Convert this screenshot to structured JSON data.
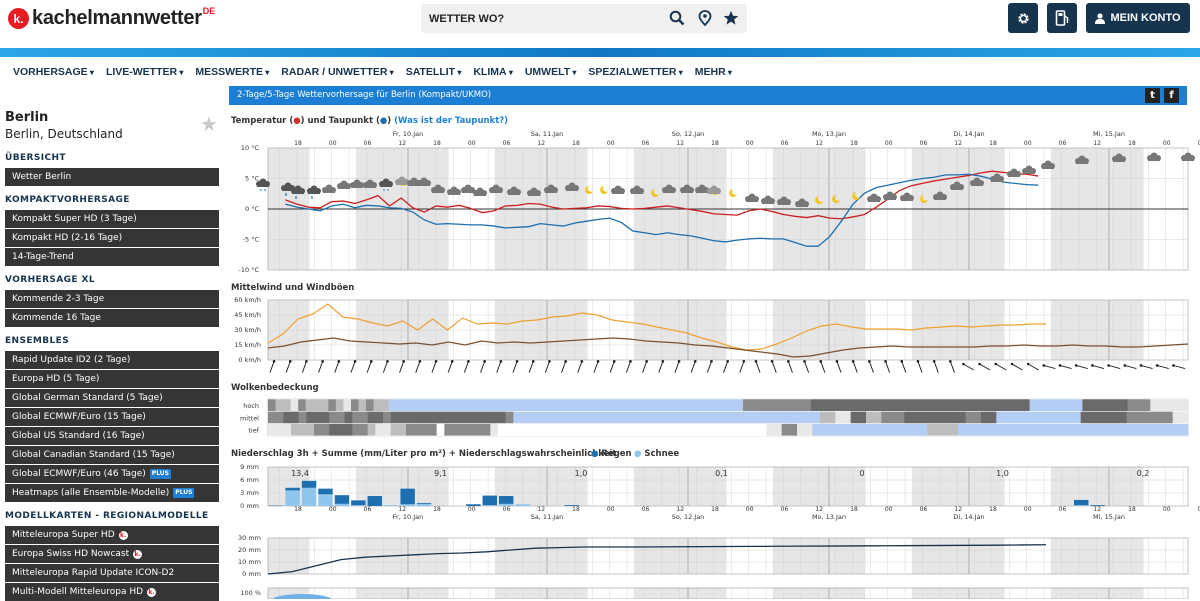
{
  "header": {
    "logo_letter": "k.",
    "logo_text": "kachelmannwetter",
    "logo_suffix": "DE",
    "search_placeholder": "WETTER WO?",
    "account_label": "MEIN KONTO"
  },
  "nav": [
    "VORHERSAGE",
    "LIVE-WETTER",
    "MESSWERTE",
    "RADAR / UNWETTER",
    "SATELLIT",
    "KLIMA",
    "UMWELT",
    "SPEZIALWETTER",
    "MEHR"
  ],
  "location": {
    "city": "Berlin",
    "country": "Berlin, Deutschland"
  },
  "sidebar": [
    {
      "title": "ÜBERSICHT",
      "items": [
        {
          "label": "Wetter Berlin"
        }
      ]
    },
    {
      "title": "KOMPAKTVORHERSAGE",
      "items": [
        {
          "label": "Kompakt Super HD (3 Tage)"
        },
        {
          "label": "Kompakt HD (2-16 Tage)"
        },
        {
          "label": "14-Tage-Trend"
        }
      ]
    },
    {
      "title": "VORHERSAGE XL",
      "items": [
        {
          "label": "Kommende 2-3 Tage"
        },
        {
          "label": "Kommende 16 Tage"
        }
      ]
    },
    {
      "title": "ENSEMBLES",
      "items": [
        {
          "label": "Rapid Update ID2 (2 Tage)"
        },
        {
          "label": "Europa HD (5 Tage)"
        },
        {
          "label": "Global German Standard (5 Tage)"
        },
        {
          "label": "Global ECMWF/Euro (15 Tage)"
        },
        {
          "label": "Global US Standard (16 Tage)"
        },
        {
          "label": "Global Canadian Standard (15 Tage)"
        },
        {
          "label": "Global ECMWF/Euro (46 Tage)",
          "badge": "PLUS"
        },
        {
          "label": "Heatmaps (alle Ensemble-Modelle)",
          "badge": "PLUS"
        }
      ]
    },
    {
      "title": "MODELLKARTEN - REGIONALMODELLE",
      "items": [
        {
          "label": "Mitteleuropa Super HD",
          "badge": "k."
        },
        {
          "label": "Europa Swiss HD Nowcast",
          "badge": "k."
        },
        {
          "label": "Mitteleuropa Rapid Update ICON-D2"
        },
        {
          "label": "Multi-Modell Mitteleuropa HD",
          "badge": "k."
        }
      ]
    }
  ],
  "banner": {
    "title": "2-Tage/5-Tage Wettervorhersage für Berlin (Kompakt/UKMO)"
  },
  "sections": {
    "temperature": {
      "title": "Temperatur (",
      "dot": "●",
      "mid": ") und Taupunkt (",
      "end": ")",
      "link": "(Was ist der Taupunkt?)"
    },
    "wind": {
      "title": "Mittelwind und Windböen"
    },
    "cloud": {
      "title": "Wolkenbedeckung",
      "levels": [
        "hoch",
        "mittel",
        "tief"
      ]
    },
    "precip": {
      "title": "Niederschlag 3h + Summe (mm/Liter pro m²) + Niederschlagswahrscheinlichkeit",
      "legend_rain": "Regen",
      "legend_snow": "Schnee"
    }
  },
  "chart_data": [
    {
      "type": "line",
      "title": "Temperatur und Taupunkt",
      "unit": "°C",
      "ylim": [
        -10,
        10
      ],
      "yticks": [
        "10 °C",
        "5 °C",
        "0 °C",
        "-5 °C",
        "-10 °C"
      ],
      "x_hours": [
        17,
        19,
        21,
        23,
        25,
        27,
        29,
        31,
        33,
        35,
        37,
        39,
        41,
        43,
        45,
        47,
        49,
        51,
        53,
        55,
        57,
        59,
        61,
        63,
        65,
        67,
        69,
        71,
        73,
        75,
        77,
        79,
        81,
        83,
        85,
        87,
        89,
        91,
        93,
        95,
        97,
        99,
        101,
        103,
        105,
        107,
        109,
        111,
        113,
        115,
        117,
        119,
        121,
        123,
        125,
        127,
        129,
        131,
        133,
        135,
        137,
        139,
        141,
        143,
        145,
        147,
        149,
        151,
        153,
        155,
        157,
        159,
        161,
        163,
        165,
        167
      ],
      "days": [
        "Fr, 10.Jan",
        "Sa, 11.Jan",
        "So, 12.Jan",
        "Mo, 13.Jan",
        "Di, 14.Jan",
        "Mi, 15.Jan"
      ],
      "hour_ticks": [
        "18",
        "00",
        "06",
        "12",
        "18",
        "00",
        "06",
        "12",
        "18",
        "00",
        "06",
        "12",
        "18",
        "00",
        "06",
        "12",
        "18",
        "00",
        "06",
        "12",
        "18",
        "00",
        "06",
        "12",
        "18",
        "00",
        "06",
        "12",
        "18",
        "00",
        "06",
        "12",
        "18"
      ],
      "series": [
        {
          "name": "Temperatur",
          "color": "#cc1f1f",
          "values": [
            1.5,
            0.8,
            0.3,
            0.2,
            1.2,
            1.3,
            0.9,
            1.5,
            2.2,
            0.5,
            1.8,
            0.2,
            -0.5,
            0.5,
            0.3,
            0.6,
            0.1,
            -0.6,
            -0.3,
            0.5,
            0.6,
            0.9,
            0.8,
            0.3,
            0.0,
            0.1,
            0.2,
            0.5,
            0.4,
            0.1,
            0.0,
            0.1,
            0.3,
            0.5,
            0.2,
            -0.1,
            -0.4,
            -0.8,
            -0.9,
            -1.0,
            -0.3,
            0.0,
            -0.4,
            -0.9,
            -1.2,
            -1.4,
            -1.1,
            -1.5,
            -1.6,
            -1.3,
            -0.9,
            0.3,
            1.6,
            3.0,
            3.8,
            4.2,
            4.6,
            4.9,
            5.2,
            5.5,
            5.9,
            6.2,
            6.0,
            5.8,
            5.7,
            5.4
          ]
        },
        {
          "name": "Taupunkt",
          "color": "#1d6fb0",
          "values": [
            0.8,
            0.3,
            0.0,
            -0.3,
            0.5,
            0.8,
            0.2,
            0.6,
            0.5,
            0.2,
            0.1,
            -0.5,
            -1.8,
            -2.5,
            -2.4,
            -2.5,
            -2.6,
            -2.6,
            -2.8,
            -3.1,
            -3.0,
            -2.9,
            -2.4,
            -2.6,
            -2.8,
            -2.3,
            -2.0,
            -1.7,
            -1.5,
            -2.2,
            -3.6,
            -3.9,
            -4.2,
            -3.9,
            -4.2,
            -4.4,
            -4.8,
            -5.2,
            -5.4,
            -5.1,
            -4.9,
            -4.8,
            -4.9,
            -4.9,
            -5.5,
            -6.1,
            -6.1,
            -4.5,
            -2.0,
            0.8,
            2.6,
            3.5,
            3.9,
            4.3,
            4.7,
            5.0,
            5.2,
            5.6,
            5.6,
            5.7,
            5.4,
            4.9,
            4.4,
            4.2,
            4.0,
            3.9
          ]
        }
      ]
    },
    {
      "type": "line",
      "title": "Mittelwind und Windböen",
      "unit": "km/h",
      "ylim": [
        0,
        60
      ],
      "yticks": [
        "60 km/h",
        "45 km/h",
        "30 km/h",
        "15 km/h",
        "0 km/h"
      ],
      "series": [
        {
          "name": "Windböen",
          "color": "#f0a030",
          "values": [
            17,
            26,
            41,
            46,
            56,
            43,
            41,
            37,
            34,
            39,
            30,
            41,
            30,
            42,
            36,
            37,
            36,
            39,
            40,
            43,
            44,
            47,
            45,
            40,
            38,
            36,
            33,
            30,
            27,
            22,
            18,
            13,
            10,
            11,
            16,
            22,
            29,
            34,
            36,
            33,
            31,
            31,
            31,
            30,
            32,
            33,
            34,
            33,
            34,
            35,
            35,
            36,
            36
          ]
        },
        {
          "name": "Mittelwind",
          "color": "#7a5030",
          "values": [
            12,
            14,
            18,
            20,
            22,
            19,
            18,
            17,
            16,
            17,
            15,
            18,
            15,
            19,
            17,
            18,
            17,
            18,
            19,
            20,
            21,
            22,
            21,
            19,
            18,
            17,
            15,
            14,
            12,
            10,
            8,
            6,
            3,
            4,
            7,
            10,
            12,
            13,
            14,
            13,
            13,
            13,
            13,
            13,
            14,
            14,
            15,
            14,
            14,
            15,
            14,
            14,
            13,
            13,
            14,
            15,
            16
          ]
        }
      ]
    },
    {
      "type": "heatmap",
      "title": "Wolkenbedeckung",
      "rows": [
        "hoch",
        "mittel",
        "tief"
      ]
    },
    {
      "type": "bar",
      "title": "Niederschlag 3h",
      "unit": "mm",
      "ylim": [
        0,
        9
      ],
      "yticks": [
        "9 mm",
        "6 mm",
        "3 mm",
        "0 mm"
      ],
      "series": [
        {
          "name": "Regen",
          "color": "#1d6fb0",
          "values": [
            0.1,
            0.6,
            1.6,
            1.3,
            2.0,
            1.1,
            2.3,
            0,
            3.6,
            0.2,
            0,
            0,
            0.4,
            2.2,
            1.8,
            0,
            0,
            0,
            0.2,
            0,
            0,
            0,
            0,
            0,
            0,
            0,
            0,
            0,
            0,
            0,
            0,
            0,
            0,
            0,
            0,
            0,
            0,
            0,
            0,
            0,
            0,
            0,
            0,
            0,
            0,
            0,
            0,
            0,
            0,
            1.2,
            0.2,
            0,
            0,
            0,
            0,
            0
          ]
        },
        {
          "name": "Schnee",
          "color": "#8fc6ee",
          "values": [
            0,
            3.6,
            4.2,
            2.7,
            0.5,
            0.2,
            0,
            0.2,
            0.4,
            0.5,
            0,
            0,
            0,
            0.2,
            0.5,
            0.4,
            0,
            0,
            0,
            0,
            0,
            0,
            0,
            0,
            0,
            0,
            0,
            0,
            0,
            0,
            0,
            0,
            0,
            0,
            0,
            0,
            0,
            0,
            0,
            0,
            0,
            0,
            0,
            0,
            0,
            0,
            0,
            0,
            0,
            0.2,
            0,
            0,
            0,
            0,
            0,
            0
          ]
        }
      ],
      "day_sums": [
        "13,4",
        "9,1",
        "1,0",
        "0,1",
        "0",
        "1,0",
        "0,2"
      ]
    },
    {
      "type": "area",
      "title": "Niederschlagssumme",
      "unit": "mm",
      "ylim": [
        0,
        30
      ],
      "yticks": [
        "30 mm",
        "20 mm",
        "10 mm",
        "0 mm"
      ],
      "series": [
        {
          "name": "Summe",
          "color": "#1d6fb0",
          "values": [
            0,
            2,
            7,
            12,
            14,
            15,
            16,
            17,
            17.5,
            18.5,
            20,
            21.5,
            22,
            22.5,
            22.5,
            22.5,
            22.6,
            22.7,
            22.8,
            22.9,
            23,
            23.1,
            23.2,
            23.3,
            23.4,
            23.5,
            23.6,
            23.7,
            23.8,
            23.9,
            24,
            24.2,
            24.4
          ]
        }
      ]
    },
    {
      "type": "area",
      "title": "Niederschlagswahrscheinlichkeit",
      "unit": "%",
      "yticks": [
        "100 %"
      ]
    }
  ],
  "colors": {
    "navy": "#17344e",
    "accent": "#1d7fd3",
    "red": "#e51c23",
    "dark_btn": "#353535"
  }
}
